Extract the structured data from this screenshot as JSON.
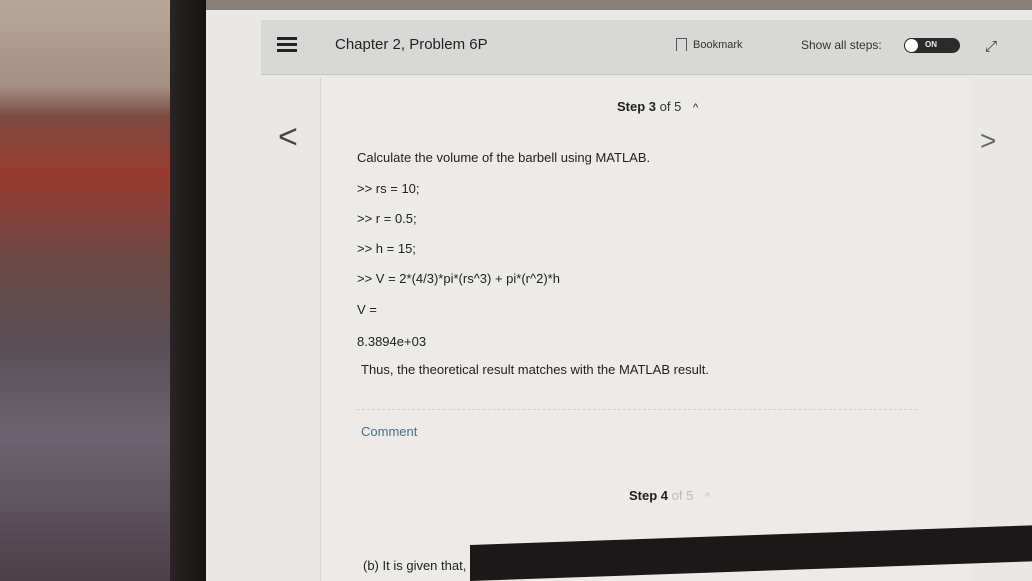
{
  "header": {
    "title": "Chapter 2, Problem 6P",
    "bookmark_label": "Bookmark",
    "show_steps_label": "Show all steps:",
    "toggle_label": "ON"
  },
  "step3": {
    "label": "Step 3",
    "of": "of 5"
  },
  "solution": {
    "intro": "Calculate the volume of the barbell using MATLAB.",
    "code": [
      ">> rs = 10;",
      ">> r = 0.5;",
      ">> h = 15;",
      ">> V = 2*(4/3)*pi*(rs^3) + pi*(r^2)*h",
      "V =",
      "8.3894e+03"
    ],
    "conclusion": "Thus, the theoretical result matches with the MATLAB result."
  },
  "comment_label": "Comment",
  "step4": {
    "label": "Step 4",
    "of": "of 5"
  },
  "next_text": "(b) It is given that,"
}
